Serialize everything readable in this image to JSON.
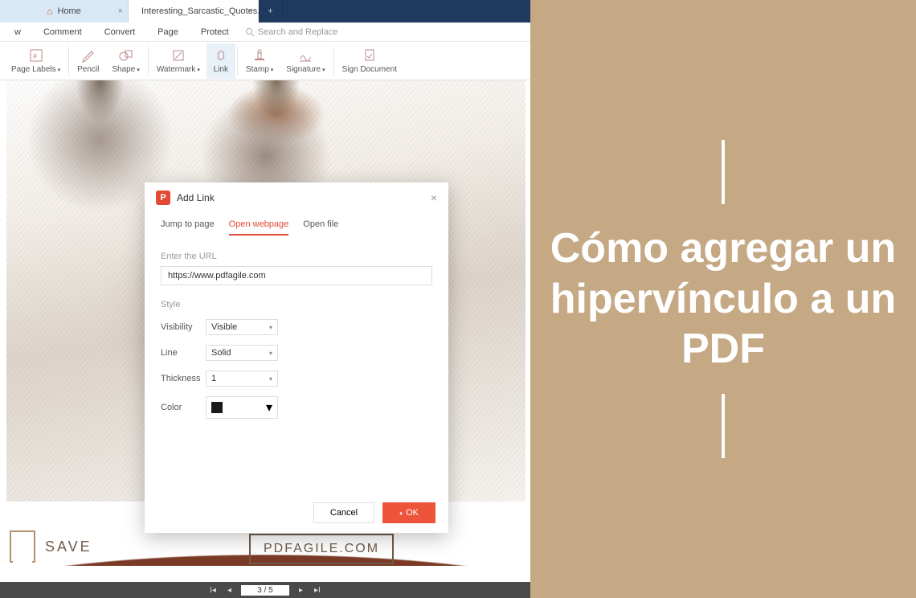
{
  "tabs": {
    "home": "Home",
    "doc": "Interesting_Sarcastic_Quotes..."
  },
  "menubar": {
    "items": [
      "w",
      "Comment",
      "Convert",
      "Page",
      "Protect"
    ],
    "search_placeholder": "Search and Replace"
  },
  "toolbar": {
    "page_labels": "Page Labels",
    "pencil": "Pencil",
    "shape": "Shape",
    "watermark": "Watermark",
    "link": "Link",
    "stamp": "Stamp",
    "signature": "Signature",
    "sign_document": "Sign Document"
  },
  "modal": {
    "title": "Add Link",
    "tabs": {
      "jump": "Jump to page",
      "web": "Open webpage",
      "file": "Open file"
    },
    "url_label": "Enter the URL",
    "url_value": "https://www.pdfagile.com",
    "style_label": "Style",
    "visibility_label": "Visibility",
    "visibility_value": "Visible",
    "line_label": "Line",
    "line_value": "Solid",
    "thickness_label": "Thickness",
    "thickness_value": "1",
    "color_label": "Color",
    "color_value": "#1a1a1a",
    "cancel": "Cancel",
    "ok": "OK"
  },
  "footer": {
    "save": "SAVE",
    "domain": "PDFAGILE.COM"
  },
  "pagenav": {
    "current": "3 / 5"
  },
  "banner": {
    "text": "Cómo agregar un hipervínculo a un PDF"
  }
}
